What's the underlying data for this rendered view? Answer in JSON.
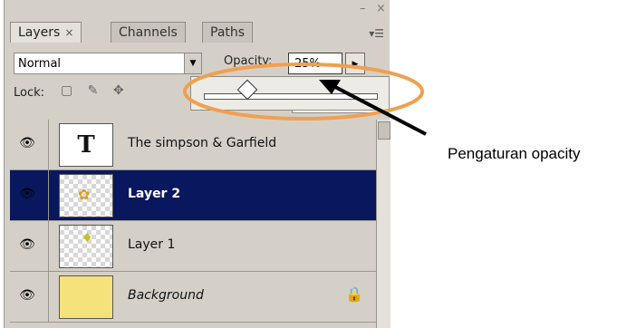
{
  "panel": {
    "tabs": [
      {
        "label": "Layers",
        "close": "×"
      },
      {
        "label": "Channels"
      },
      {
        "label": "Paths"
      }
    ],
    "window_controls": {
      "minimize": "–",
      "close": "×"
    },
    "blend_mode": "Normal",
    "opacity_label": "Opacity:",
    "opacity_value": "25%",
    "opacity_slider_fraction": 0.25,
    "lock_label": "Lock:",
    "layers": [
      {
        "name": "The simpson & Garfield",
        "type": "text",
        "thumb_glyph": "T",
        "visible": true,
        "selected": false
      },
      {
        "name": "Layer 2",
        "type": "image",
        "visible": true,
        "selected": true
      },
      {
        "name": "Layer 1",
        "type": "image",
        "visible": true,
        "selected": false
      },
      {
        "name": "Background",
        "type": "background",
        "visible": true,
        "selected": false,
        "locked": true
      }
    ]
  },
  "annotation": {
    "text": "Pengaturan opacity",
    "ellipse_color": "#f0a050",
    "arrow_color": "#000000"
  },
  "colors": {
    "panel_bg": "#d4d0c8",
    "selection": "#08175e",
    "background_thumb": "#f6e27a"
  }
}
